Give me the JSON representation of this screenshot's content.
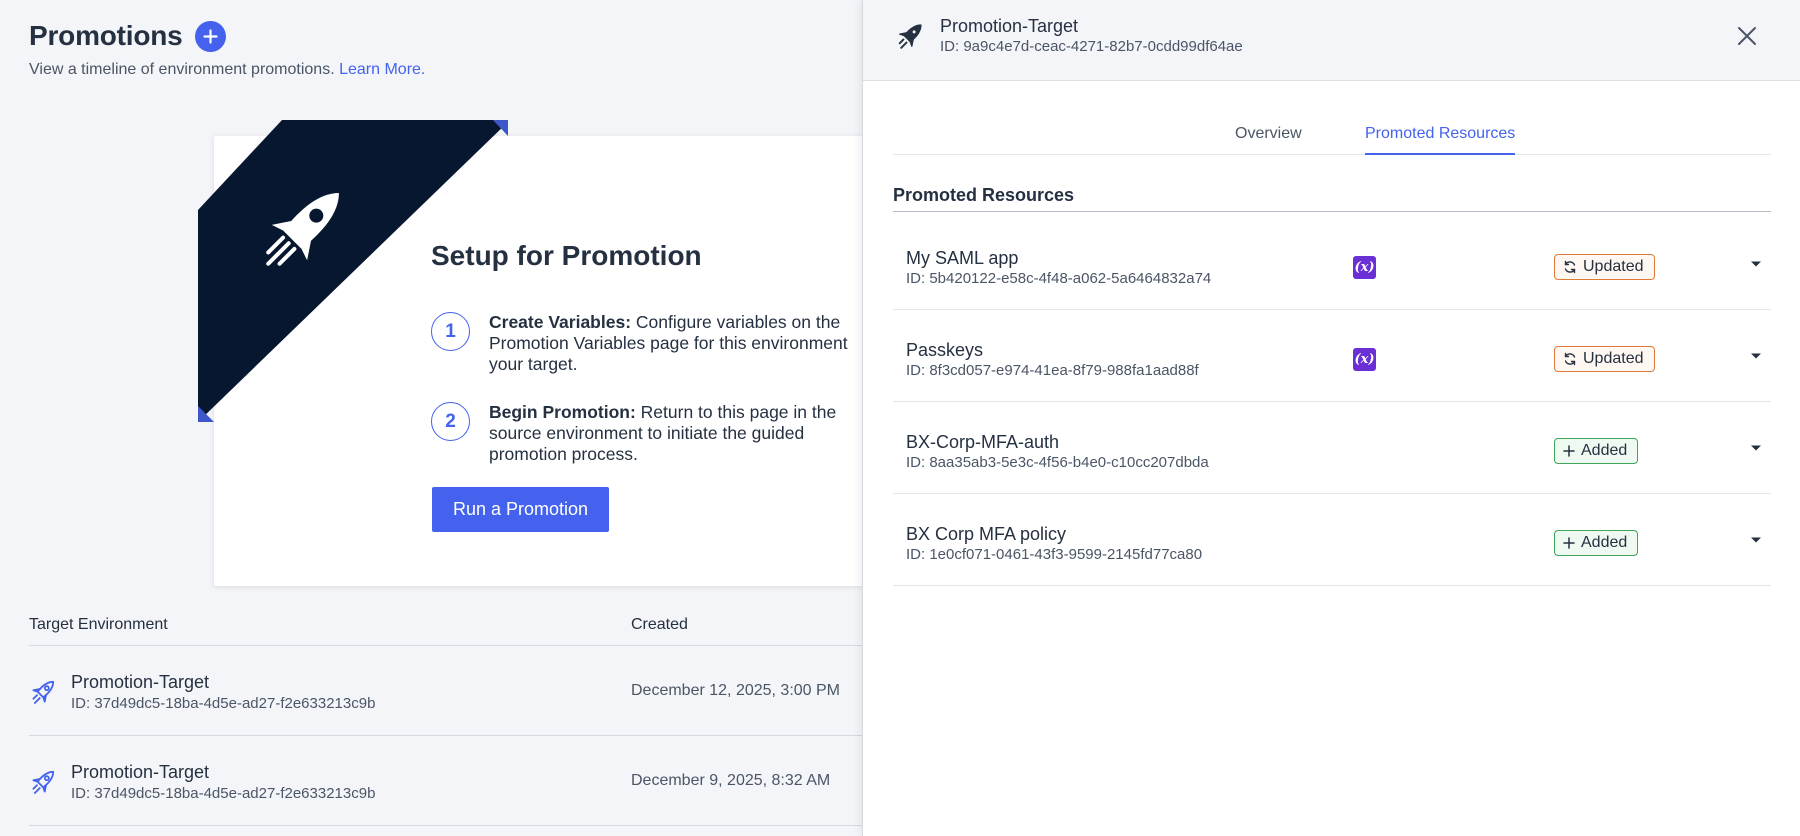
{
  "page": {
    "title": "Promotions",
    "subtitle": "View a timeline of environment promotions.",
    "learn_more": "Learn More."
  },
  "setup": {
    "title": "Setup for Promotion",
    "steps": [
      {
        "num": "1",
        "heading": "Create Variables:",
        "body": "Configure variables on the Promotion Variables page for this environment your target."
      },
      {
        "num": "2",
        "heading": "Begin Promotion:",
        "body": "Return to this page in the source environment to initiate the guided promotion process."
      }
    ],
    "button": "Run a Promotion"
  },
  "table": {
    "headers": [
      "Target Environment",
      "Created"
    ],
    "rows": [
      {
        "name": "Promotion-Target",
        "id": "ID: 37d49dc5-18ba-4d5e-ad27-f2e633213c9b",
        "created": "December 12, 2025, 3:00 PM"
      },
      {
        "name": "Promotion-Target",
        "id": "ID: 37d49dc5-18ba-4d5e-ad27-f2e633213c9b",
        "created": "December 9, 2025, 8:32 AM"
      }
    ]
  },
  "drawer": {
    "title": "Promotion-Target",
    "id": "ID: 9a9c4e7d-ceac-4271-82b7-0cdd99df64ae",
    "tabs": [
      {
        "label": "Overview",
        "active": false
      },
      {
        "label": "Promoted Resources",
        "active": true
      }
    ],
    "section_title": "Promoted Resources",
    "resources": [
      {
        "name": "My SAML app",
        "id": "ID: 5b420122-e58c-4f48-a062-5a6464832a74",
        "has_variable": true,
        "variable_icon": "(x)",
        "status": "Updated"
      },
      {
        "name": "Passkeys",
        "id": "ID: 8f3cd057-e974-41ea-8f79-988fa1aad88f",
        "has_variable": true,
        "variable_icon": "(x)",
        "status": "Updated"
      },
      {
        "name": "BX-Corp-MFA-auth",
        "id": "ID: 8aa35ab3-5e3c-4f56-b4e0-c10cc207dbda",
        "has_variable": false,
        "variable_icon": "",
        "status": "Added"
      },
      {
        "name": "BX Corp MFA policy",
        "id": "ID: 1e0cf071-0461-43f3-9599-2145fd77ca80",
        "has_variable": false,
        "variable_icon": "",
        "status": "Added"
      }
    ]
  },
  "icons": {
    "add": "plus-circle-icon",
    "banner": "rocket-icon",
    "row": "rocket-outline-icon",
    "close": "close-icon",
    "variable": "variable-icon",
    "updated": "sync-icon",
    "added": "plus-icon",
    "expand": "chevron-down-icon"
  },
  "colors": {
    "accent": "#4462ed",
    "banner": "#081730",
    "variable": "#6b2fd6",
    "updated_border": "#e07a3a",
    "added_border": "#3fa55a",
    "text": "#253041"
  }
}
